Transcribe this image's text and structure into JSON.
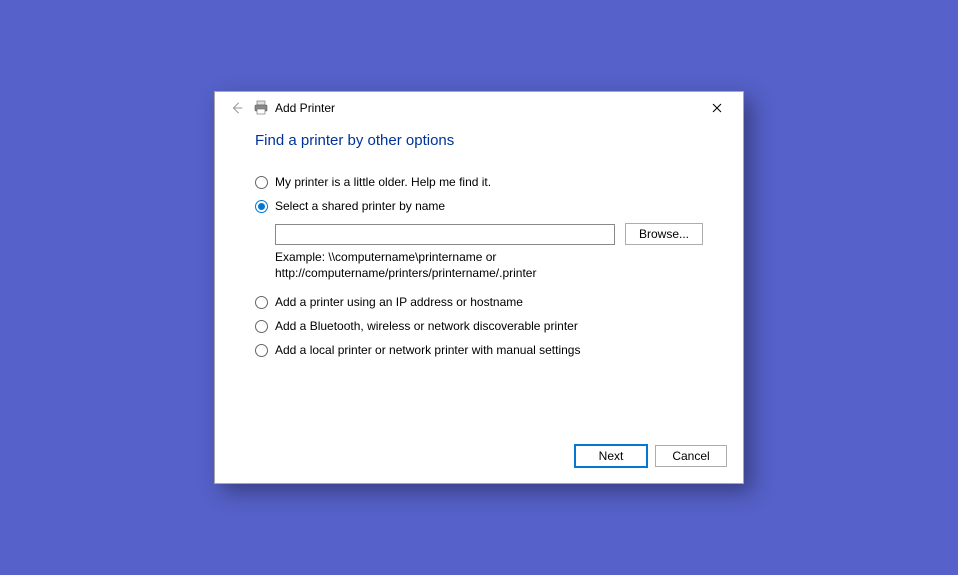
{
  "window": {
    "title": "Add Printer"
  },
  "heading": "Find a printer by other options",
  "options": {
    "older": "My printer is a little older. Help me find it.",
    "shared": "Select a shared printer by name",
    "ip": "Add a printer using an IP address or hostname",
    "bluetooth": "Add a Bluetooth, wireless or network discoverable printer",
    "local": "Add a local printer or network printer with manual settings"
  },
  "shared": {
    "input_value": "",
    "browse_label": "Browse...",
    "example": "Example: \\\\computername\\printername or http://computername/printers/printername/.printer"
  },
  "buttons": {
    "next": "Next",
    "cancel": "Cancel"
  }
}
